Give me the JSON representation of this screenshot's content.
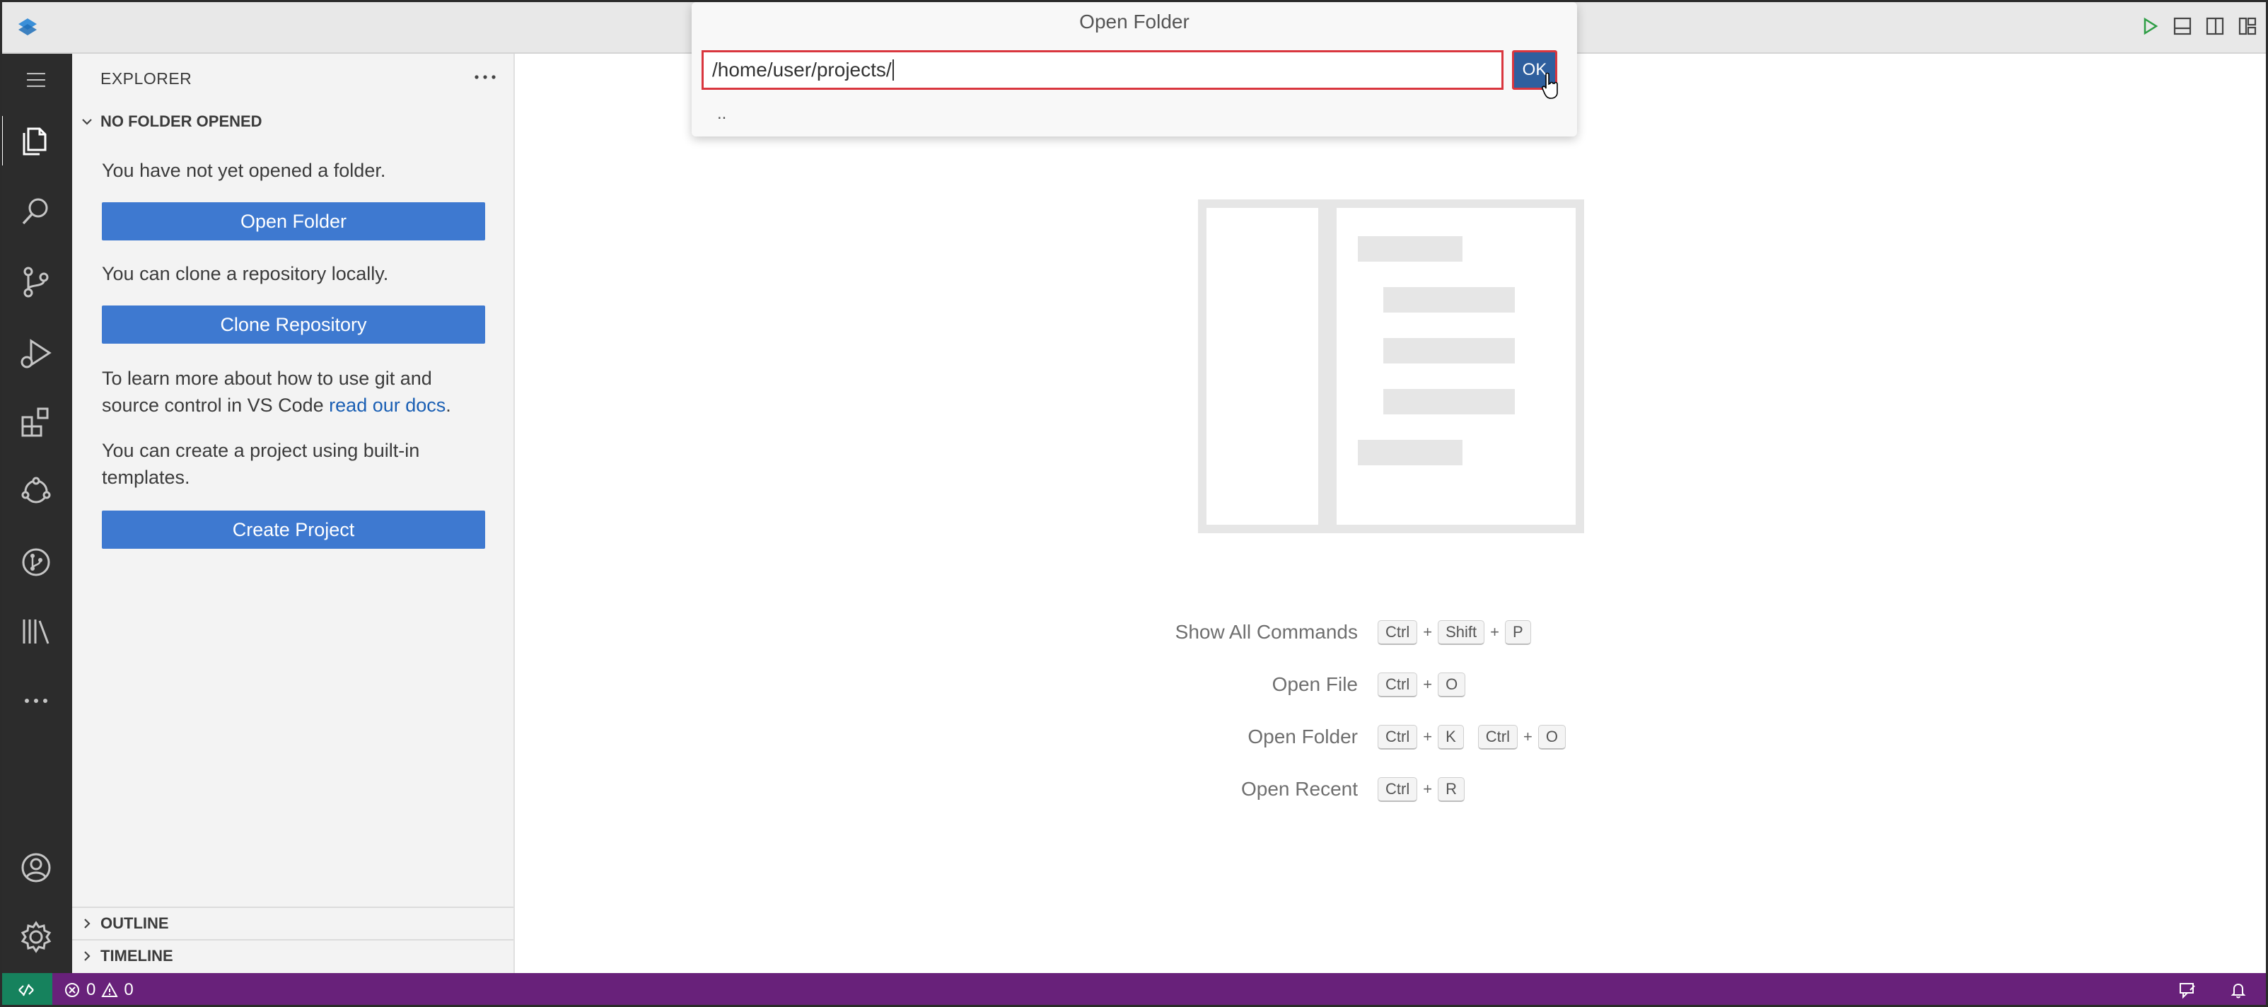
{
  "dialog": {
    "title": "Open Folder",
    "input_value": "/home/user/projects/",
    "ok_label": "OK",
    "parent_entry": ".."
  },
  "activity_bar": {
    "items": [
      "explorer-icon",
      "search-icon",
      "source-control-icon",
      "run-debug-icon",
      "extensions-icon",
      "remote-explorer-icon",
      "git-graph-icon",
      "library-icon",
      "more-icon"
    ],
    "bottom": [
      "account-icon",
      "settings-gear-icon"
    ]
  },
  "sidebar": {
    "title": "EXPLORER",
    "section": "NO FOLDER OPENED",
    "no_folder_text": "You have not yet opened a folder.",
    "open_folder_button": "Open Folder",
    "clone_text": "You can clone a repository locally.",
    "clone_button": "Clone Repository",
    "docs_text_1": "To learn more about how to use git and source control in VS Code ",
    "docs_link": "read our docs",
    "docs_text_2": ".",
    "template_text": "You can create a project using built-in templates.",
    "create_button": "Create Project",
    "outline": "OUTLINE",
    "timeline": "TIMELINE"
  },
  "shortcuts": [
    {
      "label": "Show All Commands",
      "keys": [
        [
          "Ctrl",
          "Shift",
          "P"
        ]
      ]
    },
    {
      "label": "Open File",
      "keys": [
        [
          "Ctrl",
          "O"
        ]
      ]
    },
    {
      "label": "Open Folder",
      "keys": [
        [
          "Ctrl",
          "K"
        ],
        [
          "Ctrl",
          "O"
        ]
      ]
    },
    {
      "label": "Open Recent",
      "keys": [
        [
          "Ctrl",
          "R"
        ]
      ]
    }
  ],
  "statusbar": {
    "errors": "0",
    "warnings": "0"
  },
  "colors": {
    "accent": "#3e79d0",
    "statusbar": "#68217a",
    "remote": "#16825d",
    "focus_border": "#d9363e"
  }
}
